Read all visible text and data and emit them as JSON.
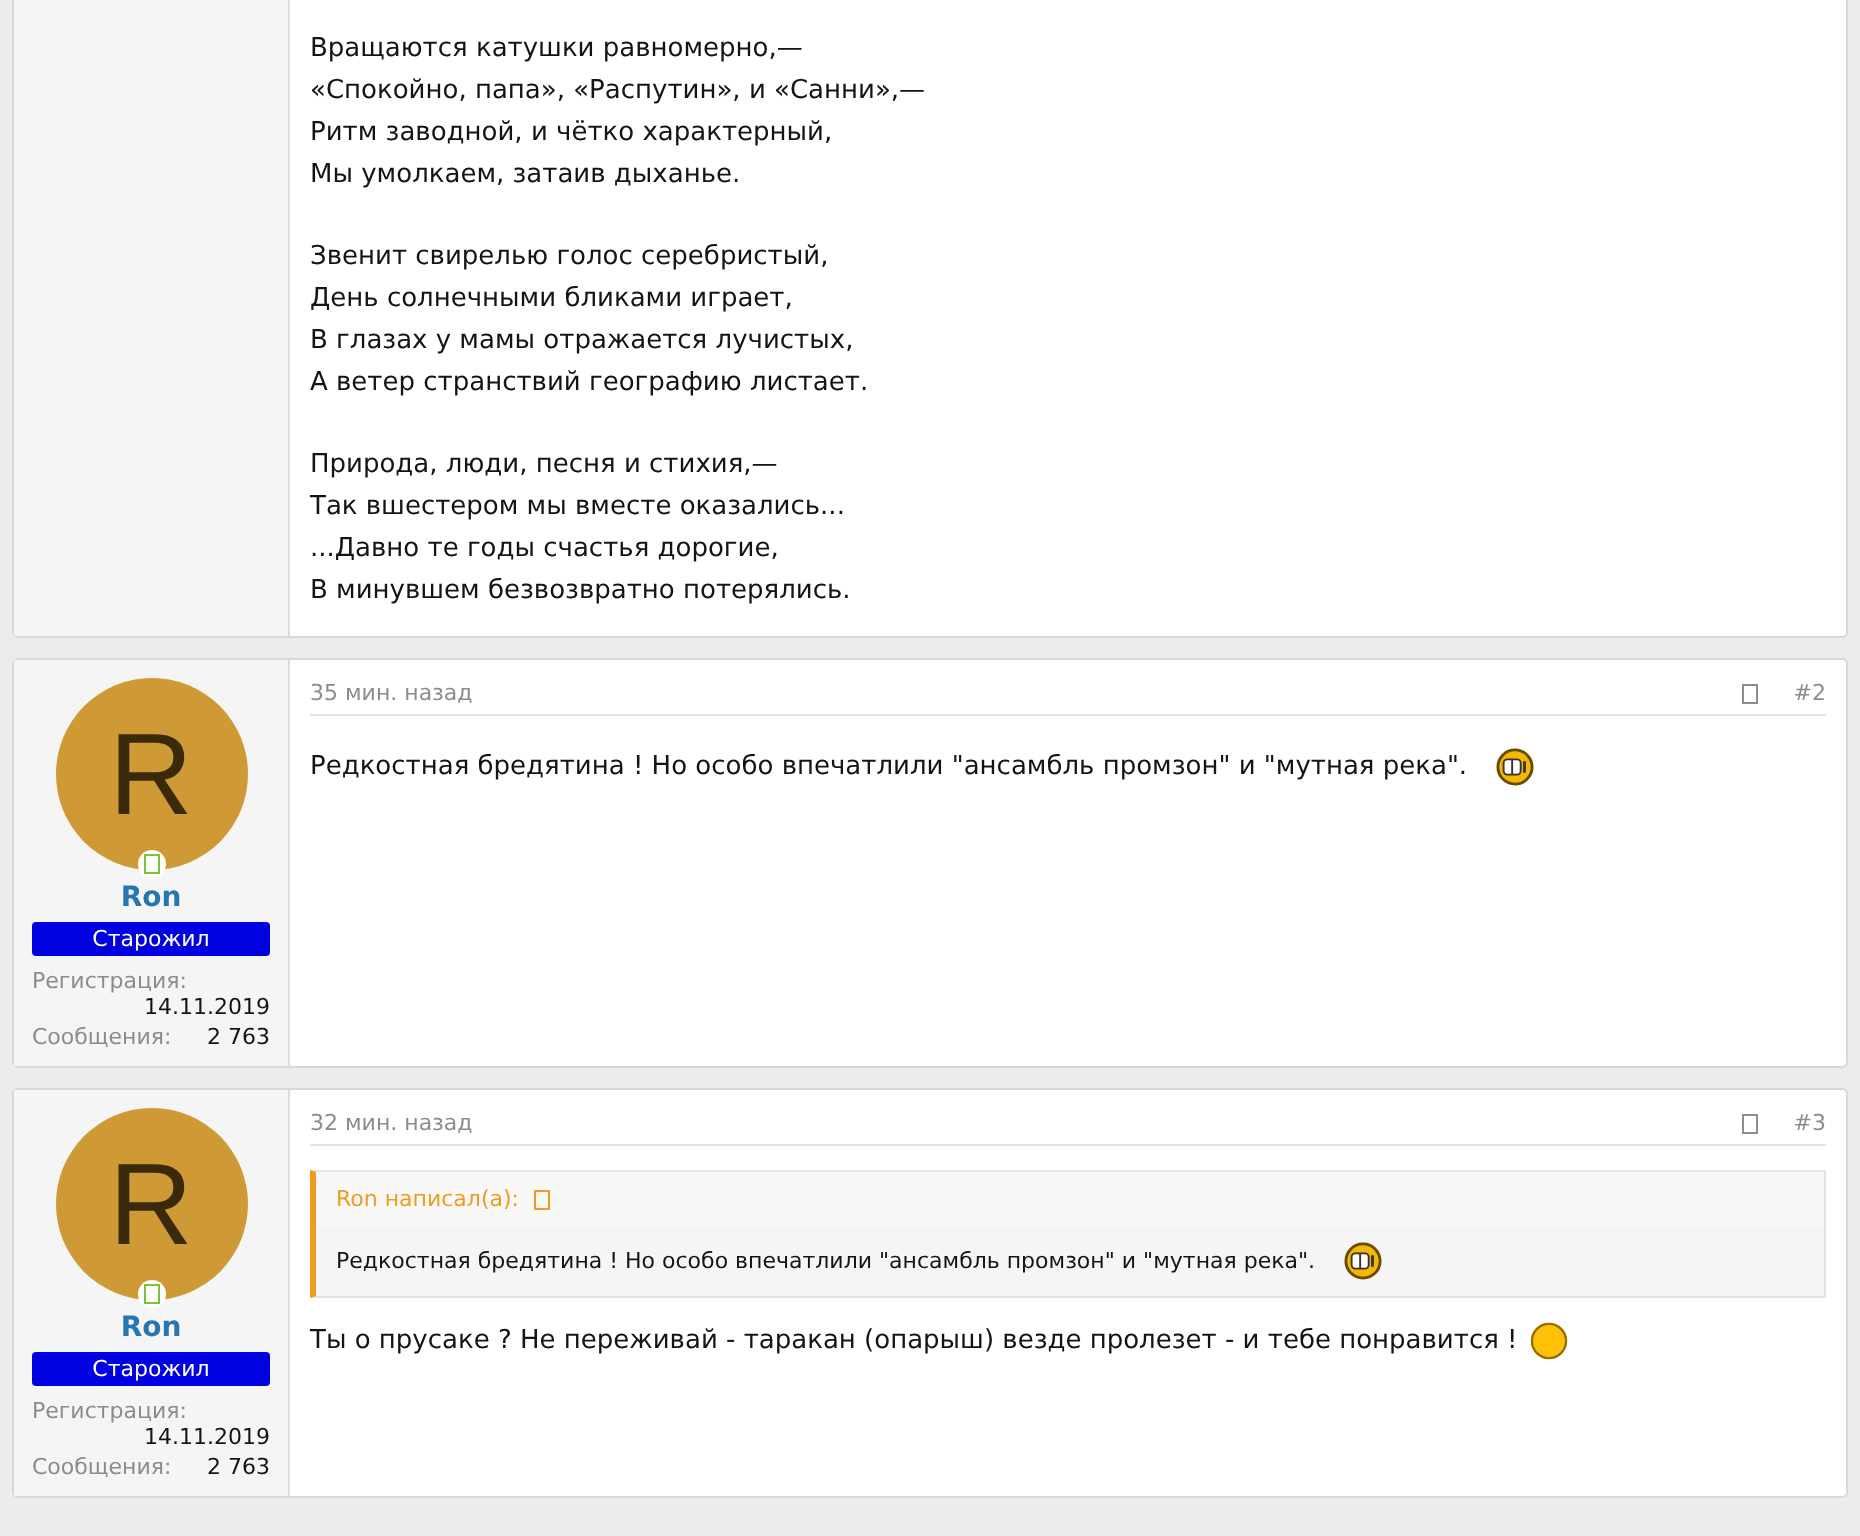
{
  "first_post": {
    "stanzas": [
      [
        "Вращаются катушки равномерно,—",
        "«Спокойно, папа», «Распутин», и «Санни»,—",
        "Ритм заводной, и чётко характерный,",
        "Мы умолкаем, затаив дыханье."
      ],
      [
        "Звенит свирелью голос серебристый,",
        "День солнечными бликами играет,",
        "В глазах у мамы отражается лучистых,",
        "А ветер странствий географию листает."
      ],
      [
        "Природа, люди, песня и стихия,—",
        "Так вшестером мы вместе оказались...",
        "...Давно те годы счастья дорогие,",
        "В минувшем безвозвратно потерялись."
      ]
    ]
  },
  "posts": [
    {
      "time": "35 мин. назад",
      "number": "#2",
      "author": {
        "initial": "R",
        "name": "Ron",
        "online": true,
        "title": "Старожил",
        "reg_label": "Регистрация:",
        "reg_date": "14.11.2019",
        "msgs_label": "Сообщения:",
        "msgs": "2 763"
      },
      "text": "Редкостная бредятина ! Но особо впечатлили \"ансамбль промзон\" и \"мутная река\".",
      "smiley": {
        "kind": "grimace"
      }
    },
    {
      "time": "32 мин. назад",
      "number": "#3",
      "author": {
        "initial": "R",
        "name": "Ron",
        "online": true,
        "title": "Старожил",
        "reg_label": "Регистрация:",
        "reg_date": "14.11.2019",
        "msgs_label": "Сообщения:",
        "msgs": "2 763"
      },
      "quote": {
        "author_line": "Ron написал(а):",
        "text": "Редкостная бредятина ! Но особо впечатлили \"ансамбль промзон\" и \"мутная река\".",
        "smiley": {
          "kind": "grimace"
        }
      },
      "text": "Ты о прусаке ? Не переживай - таракан (опарыш) везде пролезет - и тебе понравится !",
      "smiley": {
        "kind": "plain"
      }
    }
  ]
}
